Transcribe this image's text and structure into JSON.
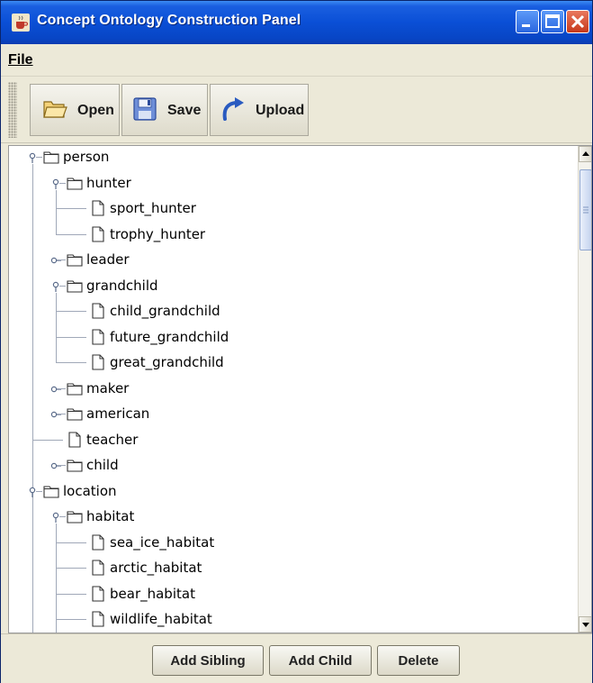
{
  "window": {
    "title": "Concept Ontology Construction Panel",
    "title_icon": "java-coffee-icon",
    "controls": [
      "minimize-icon",
      "maximize-icon",
      "close-icon"
    ]
  },
  "menubar": {
    "items": [
      {
        "label": "File"
      }
    ]
  },
  "toolbar": {
    "open_label": "Open",
    "save_label": "Save",
    "upload_label": "Upload",
    "open_icon": "folder-open-icon",
    "save_icon": "save-disk-icon",
    "upload_icon": "upload-arrow-icon"
  },
  "tree": {
    "nodes": [
      {
        "label": "person",
        "type": "folder",
        "expanded": true,
        "depth": 0
      },
      {
        "label": "hunter",
        "type": "folder",
        "expanded": true,
        "depth": 1
      },
      {
        "label": "sport_hunter",
        "type": "leaf",
        "depth": 2
      },
      {
        "label": "trophy_hunter",
        "type": "leaf",
        "depth": 2
      },
      {
        "label": "leader",
        "type": "folder",
        "expanded": false,
        "depth": 1
      },
      {
        "label": "grandchild",
        "type": "folder",
        "expanded": true,
        "depth": 1
      },
      {
        "label": "child_grandchild",
        "type": "leaf",
        "depth": 2
      },
      {
        "label": "future_grandchild",
        "type": "leaf",
        "depth": 2
      },
      {
        "label": "great_grandchild",
        "type": "leaf",
        "depth": 2
      },
      {
        "label": "maker",
        "type": "folder",
        "expanded": false,
        "depth": 1
      },
      {
        "label": "american",
        "type": "folder",
        "expanded": false,
        "depth": 1
      },
      {
        "label": "teacher",
        "type": "leaf",
        "depth": 1
      },
      {
        "label": "child",
        "type": "folder",
        "expanded": false,
        "depth": 1
      },
      {
        "label": "location",
        "type": "folder",
        "expanded": true,
        "depth": 0
      },
      {
        "label": "habitat",
        "type": "folder",
        "expanded": true,
        "depth": 1
      },
      {
        "label": "sea_ice_habitat",
        "type": "leaf",
        "depth": 2
      },
      {
        "label": "arctic_habitat",
        "type": "leaf",
        "depth": 2
      },
      {
        "label": "bear_habitat",
        "type": "leaf",
        "depth": 2
      },
      {
        "label": "wildlife_habitat",
        "type": "leaf",
        "depth": 2
      }
    ]
  },
  "actions": {
    "add_sibling_label": "Add Sibling",
    "add_child_label": "Add Child",
    "delete_label": "Delete"
  },
  "colors": {
    "titlebar": "#0a4fd6",
    "chrome": "#ece9d8",
    "close_button": "#c7391b",
    "tree_lines": "#a0a8b8"
  }
}
